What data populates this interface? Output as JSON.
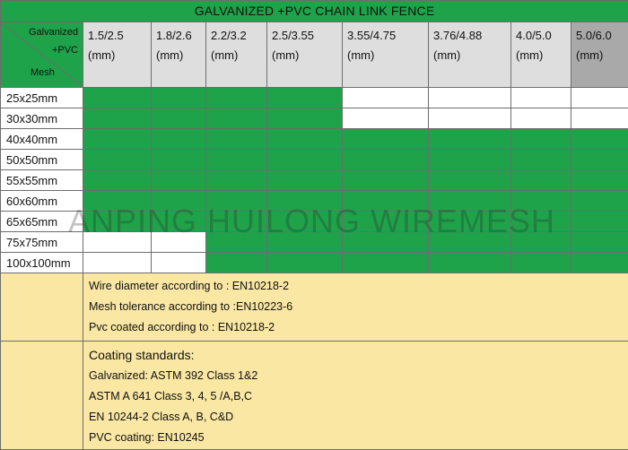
{
  "title": "GALVANIZED +PVC CHAIN LINK FENCE",
  "corner": {
    "top": "Galvanized",
    "middle": "+PVC",
    "bottom": "Mesh"
  },
  "columns": [
    {
      "size": "1.5/2.5",
      "unit": "(mm)"
    },
    {
      "size": "1.8/2.6",
      "unit": "(mm)"
    },
    {
      "size": "2.2/3.2",
      "unit": "(mm)"
    },
    {
      "size": "2.5/3.55",
      "unit": "(mm)"
    },
    {
      "size": "3.55/4.75",
      "unit": "(mm)"
    },
    {
      "size": "3.76/4.88",
      "unit": "(mm)"
    },
    {
      "size": "4.0/5.0",
      "unit": "(mm)"
    },
    {
      "size": "5.0/6.0",
      "unit": "(mm)"
    }
  ],
  "rows": [
    {
      "mesh": "25x25mm",
      "avail": [
        true,
        true,
        true,
        true,
        false,
        false,
        false,
        false
      ]
    },
    {
      "mesh": "30x30mm",
      "avail": [
        true,
        true,
        true,
        true,
        false,
        false,
        false,
        false
      ]
    },
    {
      "mesh": "40x40mm",
      "avail": [
        true,
        true,
        true,
        true,
        true,
        true,
        true,
        true
      ]
    },
    {
      "mesh": "50x50mm",
      "avail": [
        true,
        true,
        true,
        true,
        true,
        true,
        true,
        true
      ]
    },
    {
      "mesh": "55x55mm",
      "avail": [
        true,
        true,
        true,
        true,
        true,
        true,
        true,
        true
      ]
    },
    {
      "mesh": "60x60mm",
      "avail": [
        true,
        true,
        true,
        true,
        true,
        true,
        true,
        true
      ]
    },
    {
      "mesh": "65x65mm",
      "avail": [
        true,
        true,
        true,
        true,
        true,
        true,
        true,
        true
      ]
    },
    {
      "mesh": "75x75mm",
      "avail": [
        false,
        false,
        true,
        true,
        true,
        true,
        true,
        true
      ]
    },
    {
      "mesh": "100x100mm",
      "avail": [
        false,
        false,
        true,
        true,
        true,
        true,
        true,
        true
      ]
    }
  ],
  "colors": {
    "available": "#1ea34a",
    "unavailable": "#ffffff",
    "notes_bg": "#fae7a3"
  },
  "watermark": "ANPING HUILONG WIREMESH",
  "notes": [
    "Wire diameter according to : EN10218-2",
    "Mesh tolerance according to :EN10223-6",
    "Pvc coated according to : EN10218-2"
  ],
  "standards": {
    "heading": "Coating standards:",
    "items": [
      "Galvanized: ASTM 392 Class 1&2",
      "ASTM A 641 Class 3, 4, 5 /A,B,C",
      "EN 10244-2 Class A, B, C&D",
      "PVC coating: EN10245"
    ]
  }
}
